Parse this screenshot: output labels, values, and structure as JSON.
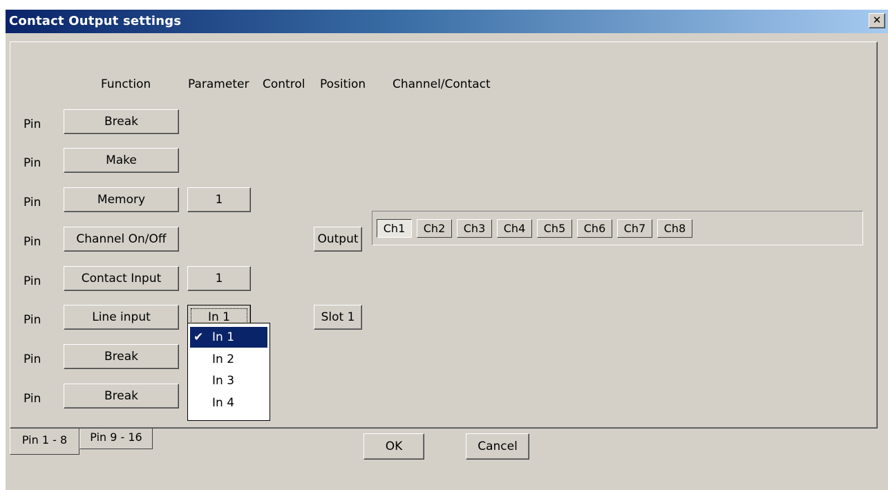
{
  "window": {
    "title": "Contact Output settings",
    "close_glyph": "✕"
  },
  "headers": {
    "function": "Function",
    "parameter": "Parameter",
    "control": "Control",
    "position": "Position",
    "channel": "Channel/Contact"
  },
  "rows": [
    {
      "pin": "Pin",
      "function": "Break",
      "parameter": null,
      "position": null
    },
    {
      "pin": "Pin",
      "function": "Make",
      "parameter": null,
      "position": null
    },
    {
      "pin": "Pin",
      "function": "Memory",
      "parameter": "1",
      "position": null
    },
    {
      "pin": "Pin",
      "function": "Channel On/Off",
      "parameter": null,
      "position": "Output"
    },
    {
      "pin": "Pin",
      "function": "Contact Input",
      "parameter": "1",
      "position": null
    },
    {
      "pin": "Pin",
      "function": "Line input",
      "parameter": "In 1",
      "position": "Slot 1"
    },
    {
      "pin": "Pin",
      "function": "Break",
      "parameter": null,
      "position": null
    },
    {
      "pin": "Pin",
      "function": "Break",
      "parameter": null,
      "position": null
    }
  ],
  "channels": {
    "items": [
      "Ch1",
      "Ch2",
      "Ch3",
      "Ch4",
      "Ch5",
      "Ch6",
      "Ch7",
      "Ch8"
    ],
    "pressed": "Ch1"
  },
  "dropdown": {
    "options": [
      "In 1",
      "In 2",
      "In 3",
      "In 4"
    ],
    "selected": "In 1",
    "check_glyph": "✔"
  },
  "tabs": {
    "active": "Pin 1 - 8",
    "inactive": "Pin 9 - 16"
  },
  "buttons": {
    "ok": "OK",
    "cancel": "Cancel"
  },
  "colors": {
    "title_start": "#0a246a",
    "title_end": "#a6caf0",
    "face": "#d4d0c8",
    "selection": "#0a246a"
  }
}
